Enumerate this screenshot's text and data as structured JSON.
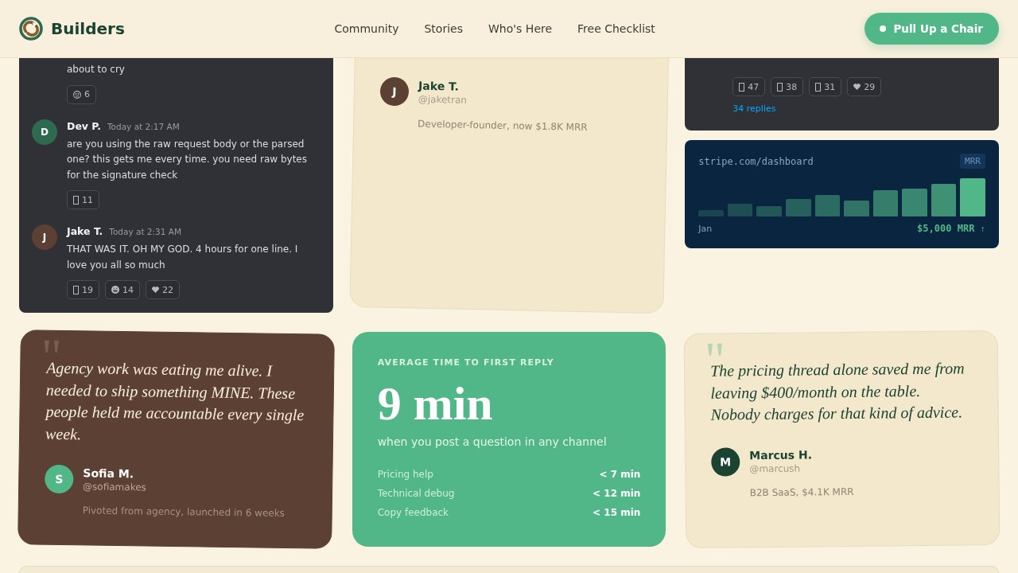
{
  "header": {
    "brand": "Builders",
    "nav": [
      "Community",
      "Stories",
      "Who's Here",
      "Free Checklist"
    ],
    "cta": "Pull Up a Chair"
  },
  "threads": [
    {
      "messages": [
        {
          "text": "about to cry",
          "reactions": [
            {
              "kind": "face",
              "count": "6"
            }
          ]
        },
        {
          "author": "Dev P.",
          "initial": "D",
          "color": "#2d6a4f",
          "time": "Today at 2:17 AM",
          "text": "are you using the raw request body or the parsed one? this gets me every time. you need raw bytes for the signature check",
          "reactions": [
            {
              "kind": "box",
              "count": "11"
            }
          ]
        },
        {
          "author": "Jake T.",
          "initial": "J",
          "color": "#5c4033",
          "time": "Today at 2:31 AM",
          "text": "THAT WAS IT. OH MY GOD. 4 hours for one line. I love you all so much",
          "reactions": [
            {
              "kind": "box",
              "count": "19"
            },
            {
              "kind": "grin",
              "count": "14"
            },
            {
              "kind": "heart",
              "count": "22"
            }
          ]
        }
      ]
    },
    {
      "messages": [
        {
          "reactions": [
            {
              "kind": "box",
              "count": "47"
            },
            {
              "kind": "box",
              "count": "38"
            },
            {
              "kind": "box",
              "count": "31"
            },
            {
              "kind": "heart",
              "count": "29"
            }
          ],
          "replies": "34 replies"
        }
      ]
    }
  ],
  "featured_story": {
    "dark": false,
    "author": {
      "name": "Jake T.",
      "initial": "J",
      "handle": "@jaketran",
      "color": "#5c4033"
    },
    "bio": "Developer-founder, now $1.8K MRR"
  },
  "dashboard": {
    "url": "stripe.com/dashboard",
    "badge": "MRR",
    "start_label": "Jan",
    "total": "$5,000 MRR",
    "trend": "↑"
  },
  "cards": [
    {
      "kind": "testimonial",
      "dark": true,
      "quote_mark": "\"",
      "quote": "Agency work was eating me alive. I needed to ship something MINE. These people held me accountable every single week.",
      "author": {
        "name": "Sofia M.",
        "initial": "S",
        "handle": "@sofiamakes",
        "color": "#52b788"
      },
      "bio": "Pivoted from agency, launched in 6 weeks"
    },
    {
      "kind": "stat",
      "eyebrow": "AVERAGE TIME TO FIRST REPLY",
      "value": "9 min",
      "caption": "when you post a question in any channel",
      "rows": [
        {
          "label": "Pricing help",
          "value": "< 7 min"
        },
        {
          "label": "Technical debug",
          "value": "< 12 min"
        },
        {
          "label": "Copy feedback",
          "value": "< 15 min"
        }
      ]
    },
    {
      "kind": "testimonial",
      "dark": false,
      "quote_mark": "\"",
      "quote": "The pricing thread alone saved me from leaving $400/month on the table. Nobody charges for that kind of advice.",
      "author": {
        "name": "Marcus H.",
        "initial": "M",
        "handle": "@marcush",
        "color": "#1b4332"
      },
      "bio": "B2B SaaS, $4.1K MRR"
    }
  ]
}
